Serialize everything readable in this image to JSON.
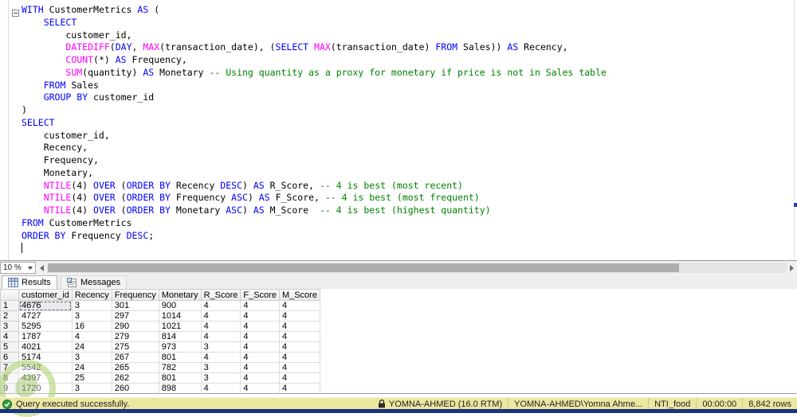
{
  "editor": {
    "zoom_value": "10 %",
    "token_colors": {
      "kw": "#0000ff",
      "fn": "#ff00ff",
      "cm": "#008000",
      "tx": "#000000"
    },
    "lines": [
      [
        {
          "s": "WITH",
          "c": "kw"
        },
        {
          "s": " CustomerMetrics ",
          "c": "tx"
        },
        {
          "s": "AS",
          "c": "kw"
        },
        {
          "s": " (",
          "c": "tx"
        }
      ],
      [
        {
          "s": "    ",
          "c": "tx"
        },
        {
          "s": "SELECT",
          "c": "kw"
        }
      ],
      [
        {
          "s": "        customer_id,",
          "c": "tx"
        }
      ],
      [
        {
          "s": "        ",
          "c": "tx"
        },
        {
          "s": "DATEDIFF",
          "c": "fn"
        },
        {
          "s": "(",
          "c": "tx"
        },
        {
          "s": "DAY",
          "c": "kw"
        },
        {
          "s": ", ",
          "c": "tx"
        },
        {
          "s": "MAX",
          "c": "fn"
        },
        {
          "s": "(transaction_date), (",
          "c": "tx"
        },
        {
          "s": "SELECT",
          "c": "kw"
        },
        {
          "s": " ",
          "c": "tx"
        },
        {
          "s": "MAX",
          "c": "fn"
        },
        {
          "s": "(transaction_date) ",
          "c": "tx"
        },
        {
          "s": "FROM",
          "c": "kw"
        },
        {
          "s": " Sales)) ",
          "c": "tx"
        },
        {
          "s": "AS",
          "c": "kw"
        },
        {
          "s": " Recency,",
          "c": "tx"
        }
      ],
      [
        {
          "s": "        ",
          "c": "tx"
        },
        {
          "s": "COUNT",
          "c": "fn"
        },
        {
          "s": "(*) ",
          "c": "tx"
        },
        {
          "s": "AS",
          "c": "kw"
        },
        {
          "s": " Frequency,",
          "c": "tx"
        }
      ],
      [
        {
          "s": "        ",
          "c": "tx"
        },
        {
          "s": "SUM",
          "c": "fn"
        },
        {
          "s": "(quantity) ",
          "c": "tx"
        },
        {
          "s": "AS",
          "c": "kw"
        },
        {
          "s": " Monetary ",
          "c": "tx"
        },
        {
          "s": "-- Using quantity as a proxy for monetary if price is not in Sales table",
          "c": "cm"
        }
      ],
      [
        {
          "s": "    ",
          "c": "tx"
        },
        {
          "s": "FROM",
          "c": "kw"
        },
        {
          "s": " Sales",
          "c": "tx"
        }
      ],
      [
        {
          "s": "    ",
          "c": "tx"
        },
        {
          "s": "GROUP BY",
          "c": "kw"
        },
        {
          "s": " customer_id",
          "c": "tx"
        }
      ],
      [
        {
          "s": ")",
          "c": "tx"
        }
      ],
      [
        {
          "s": "SELECT",
          "c": "kw"
        }
      ],
      [
        {
          "s": "    customer_id,",
          "c": "tx"
        }
      ],
      [
        {
          "s": "    Recency,",
          "c": "tx"
        }
      ],
      [
        {
          "s": "    Frequency,",
          "c": "tx"
        }
      ],
      [
        {
          "s": "    Monetary,",
          "c": "tx"
        }
      ],
      [
        {
          "s": "    ",
          "c": "tx"
        },
        {
          "s": "NTILE",
          "c": "fn"
        },
        {
          "s": "(4) ",
          "c": "tx"
        },
        {
          "s": "OVER",
          "c": "kw"
        },
        {
          "s": " (",
          "c": "tx"
        },
        {
          "s": "ORDER BY",
          "c": "kw"
        },
        {
          "s": " Recency ",
          "c": "tx"
        },
        {
          "s": "DESC",
          "c": "kw"
        },
        {
          "s": ") ",
          "c": "tx"
        },
        {
          "s": "AS",
          "c": "kw"
        },
        {
          "s": " R_Score, ",
          "c": "tx"
        },
        {
          "s": "-- 4 is best (most recent)",
          "c": "cm"
        }
      ],
      [
        {
          "s": "    ",
          "c": "tx"
        },
        {
          "s": "NTILE",
          "c": "fn"
        },
        {
          "s": "(4) ",
          "c": "tx"
        },
        {
          "s": "OVER",
          "c": "kw"
        },
        {
          "s": " (",
          "c": "tx"
        },
        {
          "s": "ORDER BY",
          "c": "kw"
        },
        {
          "s": " Frequency ",
          "c": "tx"
        },
        {
          "s": "ASC",
          "c": "kw"
        },
        {
          "s": ") ",
          "c": "tx"
        },
        {
          "s": "AS",
          "c": "kw"
        },
        {
          "s": " F_Score, ",
          "c": "tx"
        },
        {
          "s": "-- 4 is best (most frequent)",
          "c": "cm"
        }
      ],
      [
        {
          "s": "    ",
          "c": "tx"
        },
        {
          "s": "NTILE",
          "c": "fn"
        },
        {
          "s": "(4) ",
          "c": "tx"
        },
        {
          "s": "OVER",
          "c": "kw"
        },
        {
          "s": " (",
          "c": "tx"
        },
        {
          "s": "ORDER BY",
          "c": "kw"
        },
        {
          "s": " Monetary ",
          "c": "tx"
        },
        {
          "s": "ASC",
          "c": "kw"
        },
        {
          "s": ") ",
          "c": "tx"
        },
        {
          "s": "AS",
          "c": "kw"
        },
        {
          "s": " M_Score  ",
          "c": "tx"
        },
        {
          "s": "-- 4 is best (highest quantity)",
          "c": "cm"
        }
      ],
      [
        {
          "s": "FROM",
          "c": "kw"
        },
        {
          "s": " CustomerMetrics",
          "c": "tx"
        }
      ],
      [
        {
          "s": "ORDER BY",
          "c": "kw"
        },
        {
          "s": " Frequency ",
          "c": "tx"
        },
        {
          "s": "DESC",
          "c": "kw"
        },
        {
          "s": ";",
          "c": "tx"
        }
      ],
      []
    ]
  },
  "results_pane": {
    "tabs": [
      {
        "label": "Results",
        "icon": "results-grid-icon"
      },
      {
        "label": "Messages",
        "icon": "messages-icon"
      }
    ],
    "grid": {
      "columns": [
        "customer_id",
        "Recency",
        "Frequency",
        "Monetary",
        "R_Score",
        "F_Score",
        "M_Score"
      ],
      "rows": [
        [
          "4676",
          "3",
          "301",
          "900",
          "4",
          "4",
          "4"
        ],
        [
          "4727",
          "3",
          "297",
          "1014",
          "4",
          "4",
          "4"
        ],
        [
          "5295",
          "16",
          "290",
          "1021",
          "4",
          "4",
          "4"
        ],
        [
          "1787",
          "4",
          "279",
          "814",
          "4",
          "4",
          "4"
        ],
        [
          "4021",
          "24",
          "275",
          "973",
          "3",
          "4",
          "4"
        ],
        [
          "5174",
          "3",
          "267",
          "801",
          "4",
          "4",
          "4"
        ],
        [
          "5542",
          "24",
          "265",
          "782",
          "3",
          "4",
          "4"
        ],
        [
          "4397",
          "25",
          "262",
          "801",
          "3",
          "4",
          "4"
        ],
        [
          "1720",
          "3",
          "260",
          "898",
          "4",
          "4",
          "4"
        ]
      ]
    }
  },
  "status_bar": {
    "message": "Query executed successfully.",
    "server": "YOMNA-AHMED (16.0 RTM)",
    "user": "YOMNA-AHMED\\Yomna Ahme...",
    "database": "NTI_food",
    "duration": "00:00:00",
    "row_count": "8,842 rows",
    "colors": {
      "background": "#ece7a1",
      "bottom_strip": "#19337e",
      "success_icon": "#2f9e3f"
    }
  }
}
